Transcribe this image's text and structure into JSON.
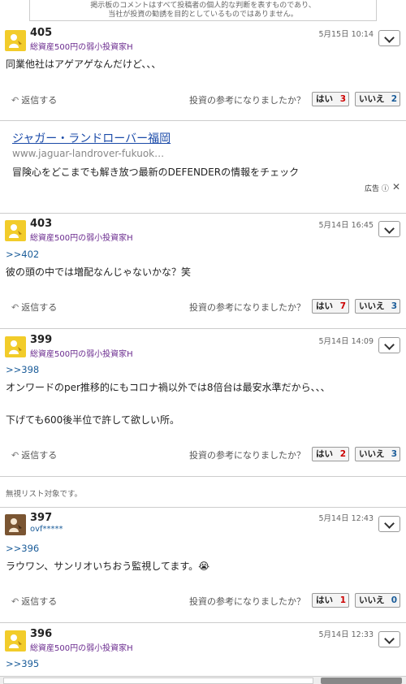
{
  "disclaimer": {
    "line1": "掲示板のコメントはすべて投稿者の個人的な判断を表すものであり、",
    "line2": "当社が投資の勧誘を目的としているものではありません。"
  },
  "common": {
    "reply_label": "返信する",
    "helpful_label": "投資の参考になりましたか？",
    "yes_label": "はい",
    "no_label": "いいえ"
  },
  "posts": [
    {
      "number": "405",
      "user": "総資産500円の弱小投資家H",
      "date": "5月15日 10:14",
      "lines": [
        "同業他社はアゲアゲなんだけど、、、"
      ],
      "yes": "3",
      "no": "2"
    },
    {
      "number": "403",
      "user": "総資産500円の弱小投資家H",
      "date": "5月14日 16:45",
      "anchor": ">>402",
      "lines": [
        "彼の頭の中では増配なんじゃないかな？笑"
      ],
      "yes": "7",
      "no": "3"
    },
    {
      "number": "399",
      "user": "総資産500円の弱小投資家H",
      "date": "5月14日 14:09",
      "anchor": ">>398",
      "lines": [
        "オンワードのper推移的にもコロナ禍以外では8倍台は最安水準だから、、、",
        "下げても600後半位で許して欲しい所。"
      ],
      "yes": "2",
      "no": "3"
    },
    {
      "number": "397",
      "user": "ovf*****",
      "date": "5月14日 12:43",
      "anchor": ">>396",
      "lines": [
        "ラウワン、サンリオいちおう監視してます。😭"
      ],
      "yes": "1",
      "no": "0"
    },
    {
      "number": "396",
      "user": "総資産500円の弱小投資家H",
      "date": "5月14日 12:33",
      "anchor": ">>395"
    }
  ],
  "ad": {
    "title": "ジャガー・ランドローバー福岡",
    "url": "www.jaguar-landrover-fukuok…",
    "description": "冒険心をどこまでも解き放つ最新のDEFENDERの情報をチェック",
    "label": "広告",
    "info_icon": "info-icon",
    "close_icon": "close-icon"
  },
  "ignored_notice": "無視リスト対象です。",
  "colors": {
    "link": "#1a5c99",
    "user": "#6a2a8e",
    "yes_count": "#cc0000",
    "avatar_default": "#f2cc2a",
    "avatar_alt": "#7a5532"
  }
}
